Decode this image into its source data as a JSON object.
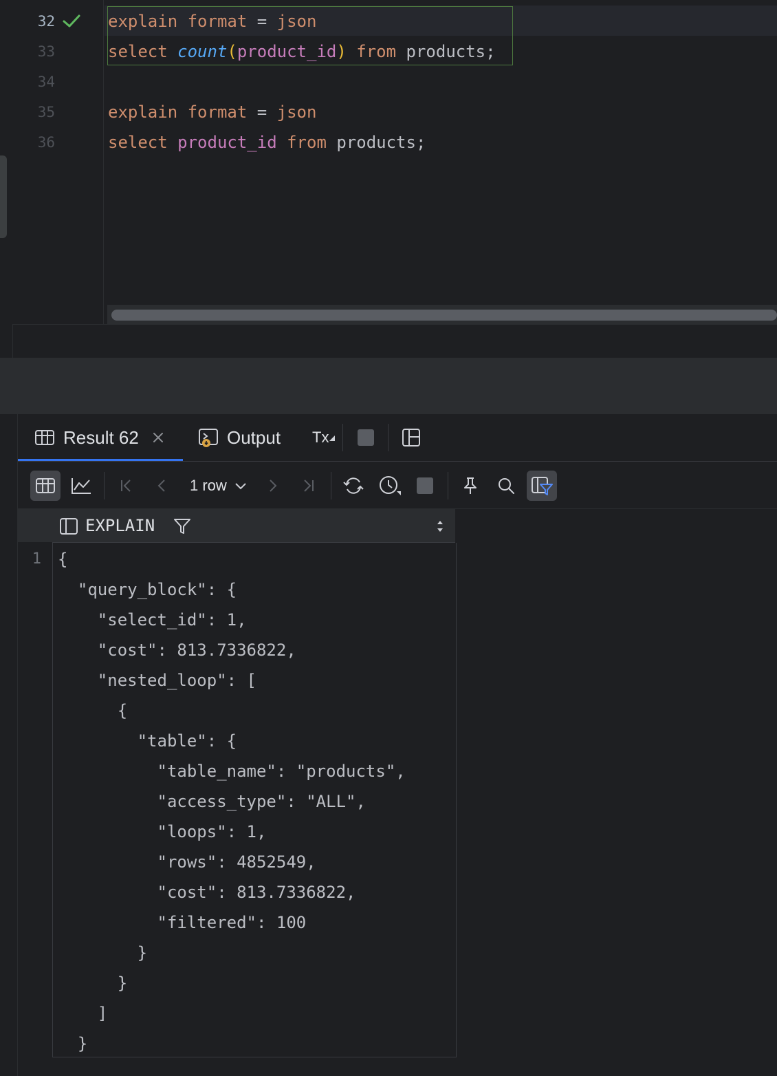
{
  "editor": {
    "line_numbers": [
      "32",
      "33",
      "34",
      "35",
      "36"
    ],
    "active_line_status": "check",
    "lines": [
      [
        {
          "t": "explain ",
          "c": "kw"
        },
        {
          "t": "format",
          "c": "kw"
        },
        {
          "t": " = ",
          "c": "plain"
        },
        {
          "t": "json",
          "c": "kw"
        }
      ],
      [
        {
          "t": "select ",
          "c": "kw"
        },
        {
          "t": "count",
          "c": "fn"
        },
        {
          "t": "(",
          "c": "par"
        },
        {
          "t": "product_id",
          "c": "col"
        },
        {
          "t": ")",
          "c": "par"
        },
        {
          "t": " from ",
          "c": "kw"
        },
        {
          "t": "products;",
          "c": "plain"
        }
      ],
      [],
      [
        {
          "t": "explain ",
          "c": "kw"
        },
        {
          "t": "format",
          "c": "kw"
        },
        {
          "t": " = ",
          "c": "plain"
        },
        {
          "t": "json",
          "c": "kw"
        }
      ],
      [
        {
          "t": "select ",
          "c": "kw"
        },
        {
          "t": "product_id",
          "c": "col"
        },
        {
          "t": " from ",
          "c": "kw"
        },
        {
          "t": "products;",
          "c": "plain"
        }
      ]
    ]
  },
  "results": {
    "tabs": {
      "result_label": "Result 62",
      "output_label": "Output",
      "tx_label": "Tx"
    },
    "toolbar": {
      "row_count": "1 row"
    },
    "grid": {
      "column_header": "EXPLAIN",
      "row_number": "1",
      "cell_lines": [
        "{",
        "  \"query_block\": {",
        "    \"select_id\": 1,",
        "    \"cost\": 813.7336822,",
        "    \"nested_loop\": [",
        "      {",
        "        \"table\": {",
        "          \"table_name\": \"products\",",
        "          \"access_type\": \"ALL\",",
        "          \"loops\": 1,",
        "          \"rows\": 4852549,",
        "          \"cost\": 813.7336822,",
        "          \"filtered\": 100",
        "        }",
        "      }",
        "    ]",
        "  }"
      ]
    }
  },
  "colors": {
    "keyword": "#cf8e6d",
    "function": "#56a8f5",
    "column": "#c77dbb",
    "paren": "#e8ba36",
    "accent": "#3574f0",
    "success": "#5fb85f"
  }
}
